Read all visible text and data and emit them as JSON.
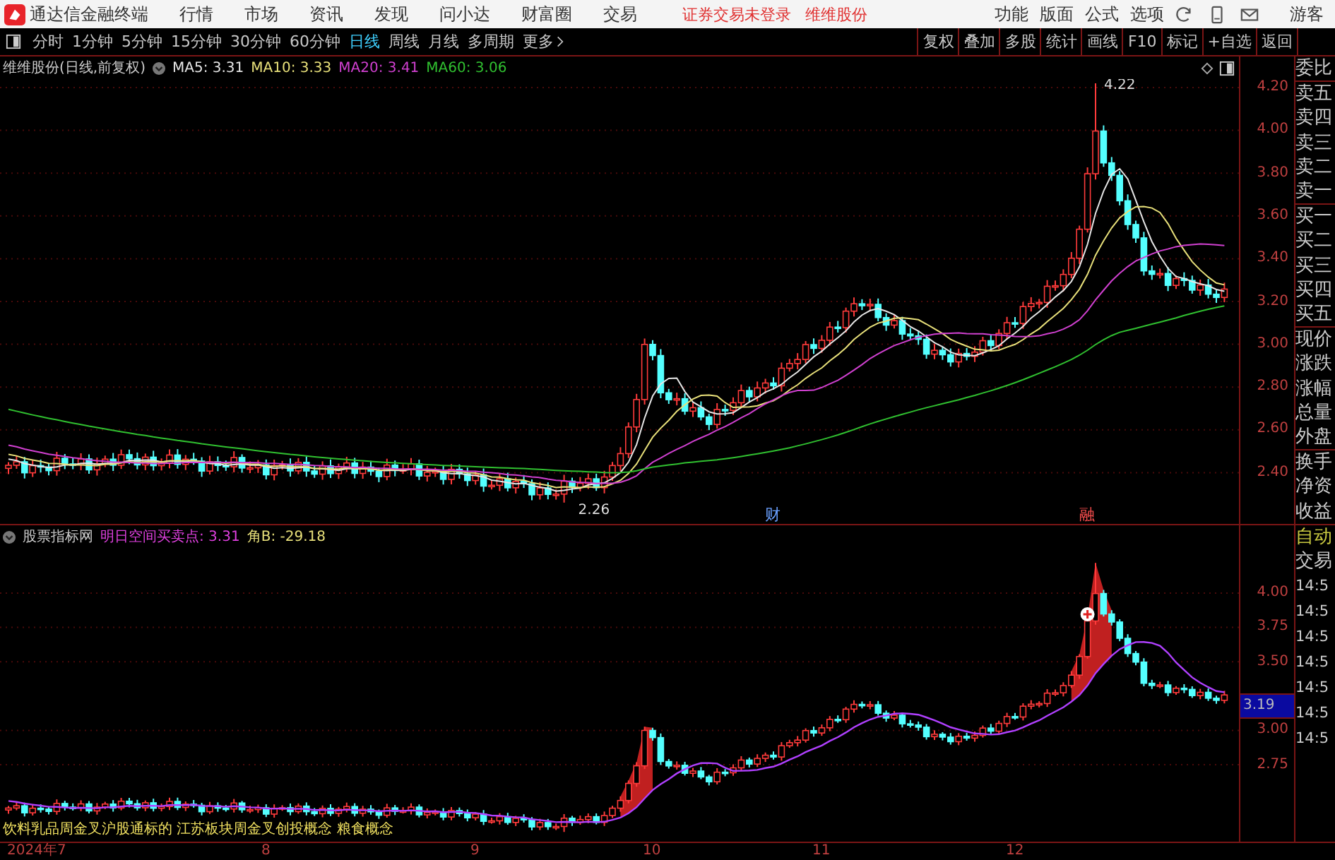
{
  "menu_bar": {
    "app_title": "通达信金融终端",
    "items": [
      "行情",
      "市场",
      "资讯",
      "发现",
      "问小达",
      "财富圈",
      "交易"
    ],
    "login_status": "证券交易未登录",
    "stock_name": "维维股份",
    "tools": [
      "功能",
      "版面",
      "公式",
      "选项"
    ],
    "user": "游客"
  },
  "period_tabs": [
    {
      "label": "分时",
      "selected": false
    },
    {
      "label": "1分钟",
      "selected": false
    },
    {
      "label": "5分钟",
      "selected": false
    },
    {
      "label": "15分钟",
      "selected": false
    },
    {
      "label": "30分钟",
      "selected": false
    },
    {
      "label": "60分钟",
      "selected": false
    },
    {
      "label": "日线",
      "selected": true
    },
    {
      "label": "周线",
      "selected": false
    },
    {
      "label": "月线",
      "selected": false
    },
    {
      "label": "多周期",
      "selected": false
    },
    {
      "label": "更多",
      "selected": false
    }
  ],
  "chart_buttons": [
    "复权",
    "叠加",
    "多股",
    "统计",
    "画线",
    "F10",
    "标记",
    "+自选",
    "返回"
  ],
  "main_chart": {
    "title": "维维股份(日线,前复权)",
    "indicators": [
      {
        "label": "MA5: 3.31",
        "color": "#e6e6e6"
      },
      {
        "label": "MA10: 3.33",
        "color": "#e8e07a"
      },
      {
        "label": "MA20: 3.41",
        "color": "#d040d0"
      },
      {
        "label": "MA60: 3.06",
        "color": "#30c030"
      }
    ],
    "y_ticks": [
      "4.20",
      "4.00",
      "3.80",
      "3.60",
      "3.40",
      "3.20",
      "3.00",
      "2.80",
      "2.60",
      "2.40"
    ],
    "high_label": "4.22",
    "low_label": "2.26",
    "event_marks": [
      "财",
      "融"
    ]
  },
  "indicator_panel": {
    "title": "股票指标网",
    "signal_label": "明日空间买卖点: 3.31",
    "angle_label": "角B: -29.18",
    "y_ticks": [
      "4.00",
      "3.75",
      "3.50",
      "3.00",
      "2.75"
    ],
    "current_value": "3.19",
    "concepts": "饮料乳品周金叉沪股通标的 江苏板块周金叉创投概念 粮食概念"
  },
  "x_axis": [
    "2024年7",
    "8",
    "9",
    "10",
    "11",
    "12"
  ],
  "quote_panel": {
    "groups": [
      {
        "labels": [
          "委比"
        ]
      },
      {
        "labels": [
          "卖五",
          "卖四",
          "卖三",
          "卖二",
          "卖一"
        ]
      },
      {
        "labels": [
          "买一",
          "买二",
          "买三",
          "买四",
          "买五"
        ]
      },
      {
        "labels": [
          "现价",
          "涨跌",
          "涨幅",
          "总量",
          "外盘"
        ]
      },
      {
        "labels": [
          "换手",
          "净资",
          "收益"
        ]
      }
    ],
    "mode": "自动",
    "trade_label": "交易",
    "times": [
      "14:5",
      "14:5",
      "14:5",
      "14:5",
      "14:5",
      "14:5",
      "14:5"
    ]
  }
}
